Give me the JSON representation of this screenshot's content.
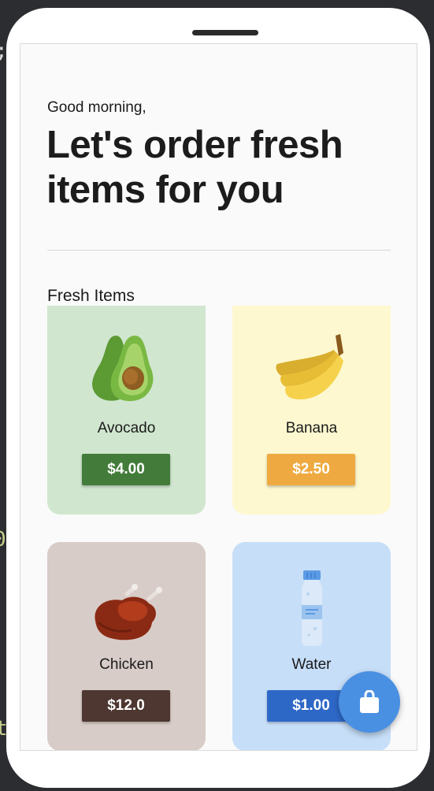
{
  "header": {
    "greeting": "Good morning,",
    "headline": "Let's order fresh items for you"
  },
  "section": {
    "title": "Fresh Items"
  },
  "items": [
    {
      "name": "Avocado",
      "price": "$4.00",
      "icon": "avocado-icon",
      "card_color": "#d0e6cf",
      "price_color": "#437c3a"
    },
    {
      "name": "Banana",
      "price": "$2.50",
      "icon": "banana-icon",
      "card_color": "#fdf8cf",
      "price_color": "#eeaa40"
    },
    {
      "name": "Chicken",
      "price": "$12.0",
      "icon": "chicken-icon",
      "card_color": "#d8ccc8",
      "price_color": "#4d3730"
    },
    {
      "name": "Water",
      "price": "$1.00",
      "icon": "water-bottle-icon",
      "card_color": "#c6def8",
      "price_color": "#2e68c7"
    }
  ],
  "fab": {
    "icon": "shopping-bag-icon",
    "color": "#4a90e2"
  }
}
